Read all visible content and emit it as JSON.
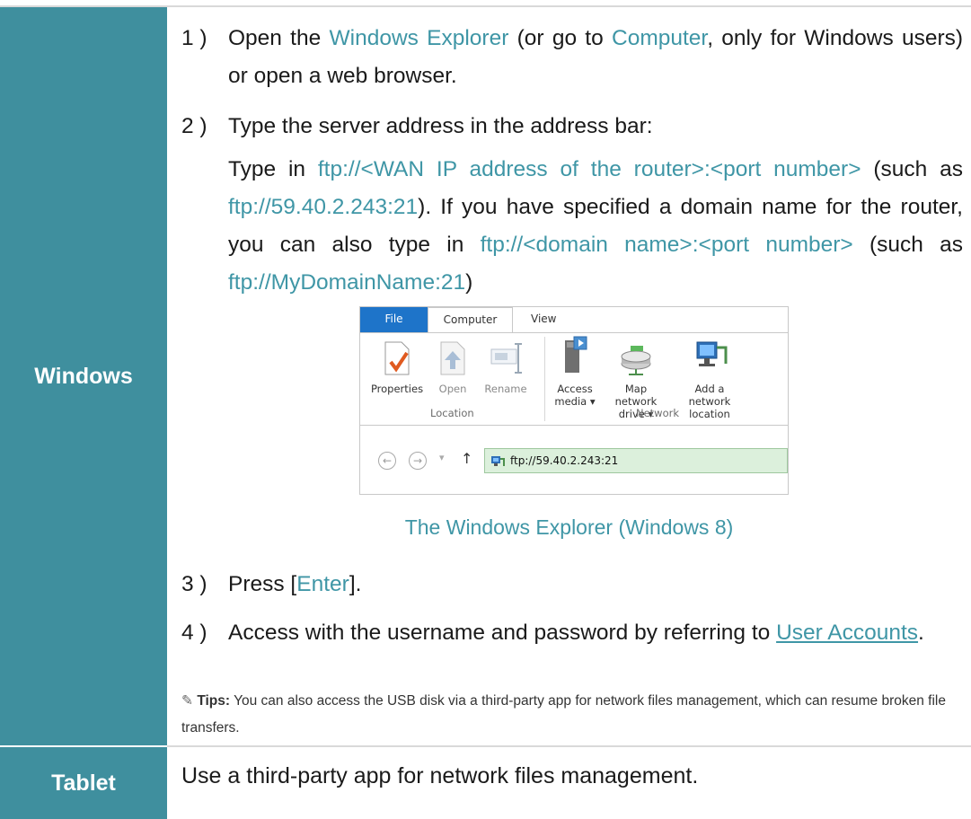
{
  "rows": [
    {
      "label": "Windows"
    },
    {
      "label": "Tablet",
      "text": "Use a third-party app for network files management."
    }
  ],
  "steps": {
    "s1": {
      "num": "1 )",
      "p1": "Open the ",
      "link1": "Windows Explorer",
      "p2": " (or go to ",
      "link2": "Computer",
      "p3": ", only for Windows users) or open a web browser."
    },
    "s2": {
      "num": "2 )",
      "text": "Type the server address in the address bar:",
      "p1": "Type in ",
      "link1": "ftp://<WAN IP address of the router>:<port number>",
      "p2": " (such as ",
      "link2": "ftp://59.40.2.243:21",
      "p3": "). If you have specified a domain name for the router, you can also type in ",
      "link3": "ftp://<domain name>:<port number>",
      "p4": " (such as ",
      "link4": "ftp://MyDomainName:21",
      "p5": ")"
    },
    "s3": {
      "num": "3 )",
      "p1": "Press [",
      "link1": "Enter",
      "p2": "]."
    },
    "s4": {
      "num": "4 )",
      "p1": "Access with the username and password by referring to ",
      "link1": "User Accounts",
      "p2": "."
    }
  },
  "explorer": {
    "tabs": {
      "file": "File",
      "computer": "Computer",
      "view": "View"
    },
    "location": {
      "properties": "Properties",
      "open": "Open",
      "rename": "Rename",
      "label": "Location"
    },
    "network": {
      "access_media_1": "Access",
      "access_media_2": "media ▾",
      "map_drive_1": "Map network",
      "map_drive_2": "drive ▾",
      "add_location_1": "Add a network",
      "add_location_2": "location",
      "label": "Network"
    },
    "address": "ftp://59.40.2.243:21"
  },
  "caption": "The Windows Explorer (Windows 8)",
  "tips": {
    "label": "Tips:",
    "text": " You can also access the USB disk via a third-party app for network files management, which can resume broken file transfers."
  },
  "colors": {
    "accent": "#3f8f9e",
    "link": "#3f96a6"
  }
}
